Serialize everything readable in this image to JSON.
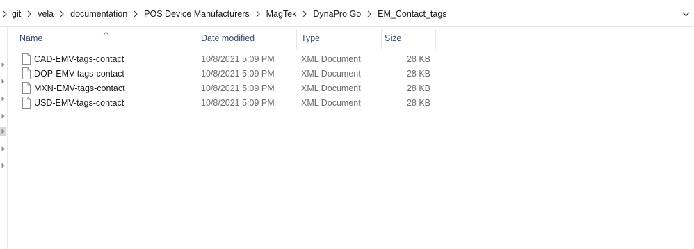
{
  "breadcrumb": {
    "items": [
      "git",
      "vela",
      "documentation",
      "POS Device Manufacturers",
      "MagTek",
      "DynaPro Go",
      "EM_Contact_tags"
    ]
  },
  "columns": {
    "name": "Name",
    "date_modified": "Date modified",
    "type": "Type",
    "size": "Size"
  },
  "files": [
    {
      "name": "CAD-EMV-tags-contact",
      "date_modified": "10/8/2021 5:09 PM",
      "type": "XML Document",
      "size": "28 KB"
    },
    {
      "name": "DOP-EMV-tags-contact",
      "date_modified": "10/8/2021 5:09 PM",
      "type": "XML Document",
      "size": "28 KB"
    },
    {
      "name": "MXN-EMV-tags-contact",
      "date_modified": "10/8/2021 5:09 PM",
      "type": "XML Document",
      "size": "28 KB"
    },
    {
      "name": "USD-EMV-tags-contact",
      "date_modified": "10/8/2021 5:09 PM",
      "type": "XML Document",
      "size": "28 KB"
    }
  ],
  "icons": {
    "breadcrumb_separator": "chevron-right-icon",
    "address_dropdown": "chevron-down-icon",
    "file": "file-icon",
    "sort": "sort-ascending-icon"
  }
}
